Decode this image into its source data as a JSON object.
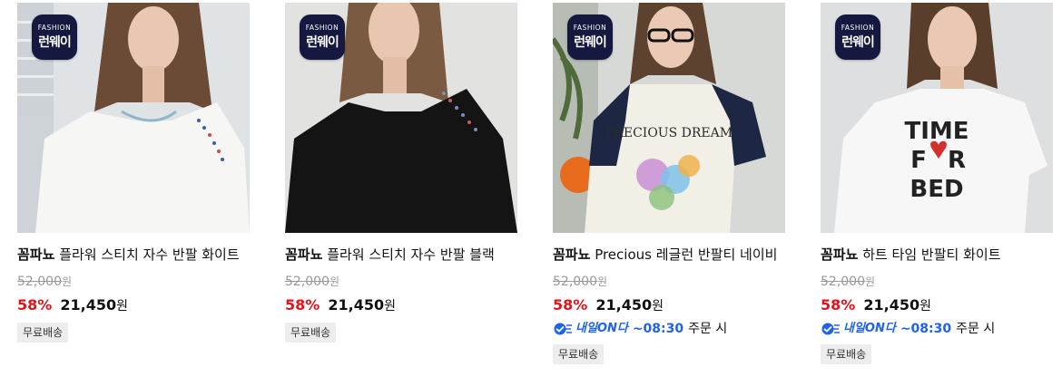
{
  "badge": {
    "top": "FASHION",
    "bottom": "런웨이"
  },
  "products": [
    {
      "brand": "꼼파뇨",
      "name": "플라워 스티치 자수 반팔 화이트",
      "original_price": "52,000",
      "currency": "원",
      "discount": "58%",
      "price": "21,450",
      "delivery": null,
      "chip": "무료배송"
    },
    {
      "brand": "꼼파뇨",
      "name": "플라워 스티치 자수 반팔 블랙",
      "original_price": "52,000",
      "currency": "원",
      "discount": "58%",
      "price": "21,450",
      "delivery": null,
      "chip": "무료배송"
    },
    {
      "brand": "꼼파뇨",
      "name": "Precious 레글런 반팔티 네이비",
      "original_price": "52,000",
      "currency": "원",
      "discount": "58%",
      "price": "21,450",
      "delivery": {
        "name": "내일ON다",
        "time": "~08:30",
        "suffix": "주문 시"
      },
      "chip": "무료배송"
    },
    {
      "brand": "꼼파뇨",
      "name": "하트 타임 반팔티 화이트",
      "original_price": "52,000",
      "currency": "원",
      "discount": "58%",
      "price": "21,450",
      "delivery": {
        "name": "내일ON다",
        "time": "~08:30",
        "suffix": "주문 시"
      },
      "chip": "무료배송"
    }
  ],
  "shirt_prints": {
    "p3_text": "PRECIOUS DREAM",
    "p4_line1": "TIME",
    "p4_line2": "F",
    "p4_line3": "R",
    "p4_line4": "BED"
  },
  "colors": {
    "discount": "#e0141e",
    "delivery": "#1e63e8",
    "badge": "#15183f"
  }
}
